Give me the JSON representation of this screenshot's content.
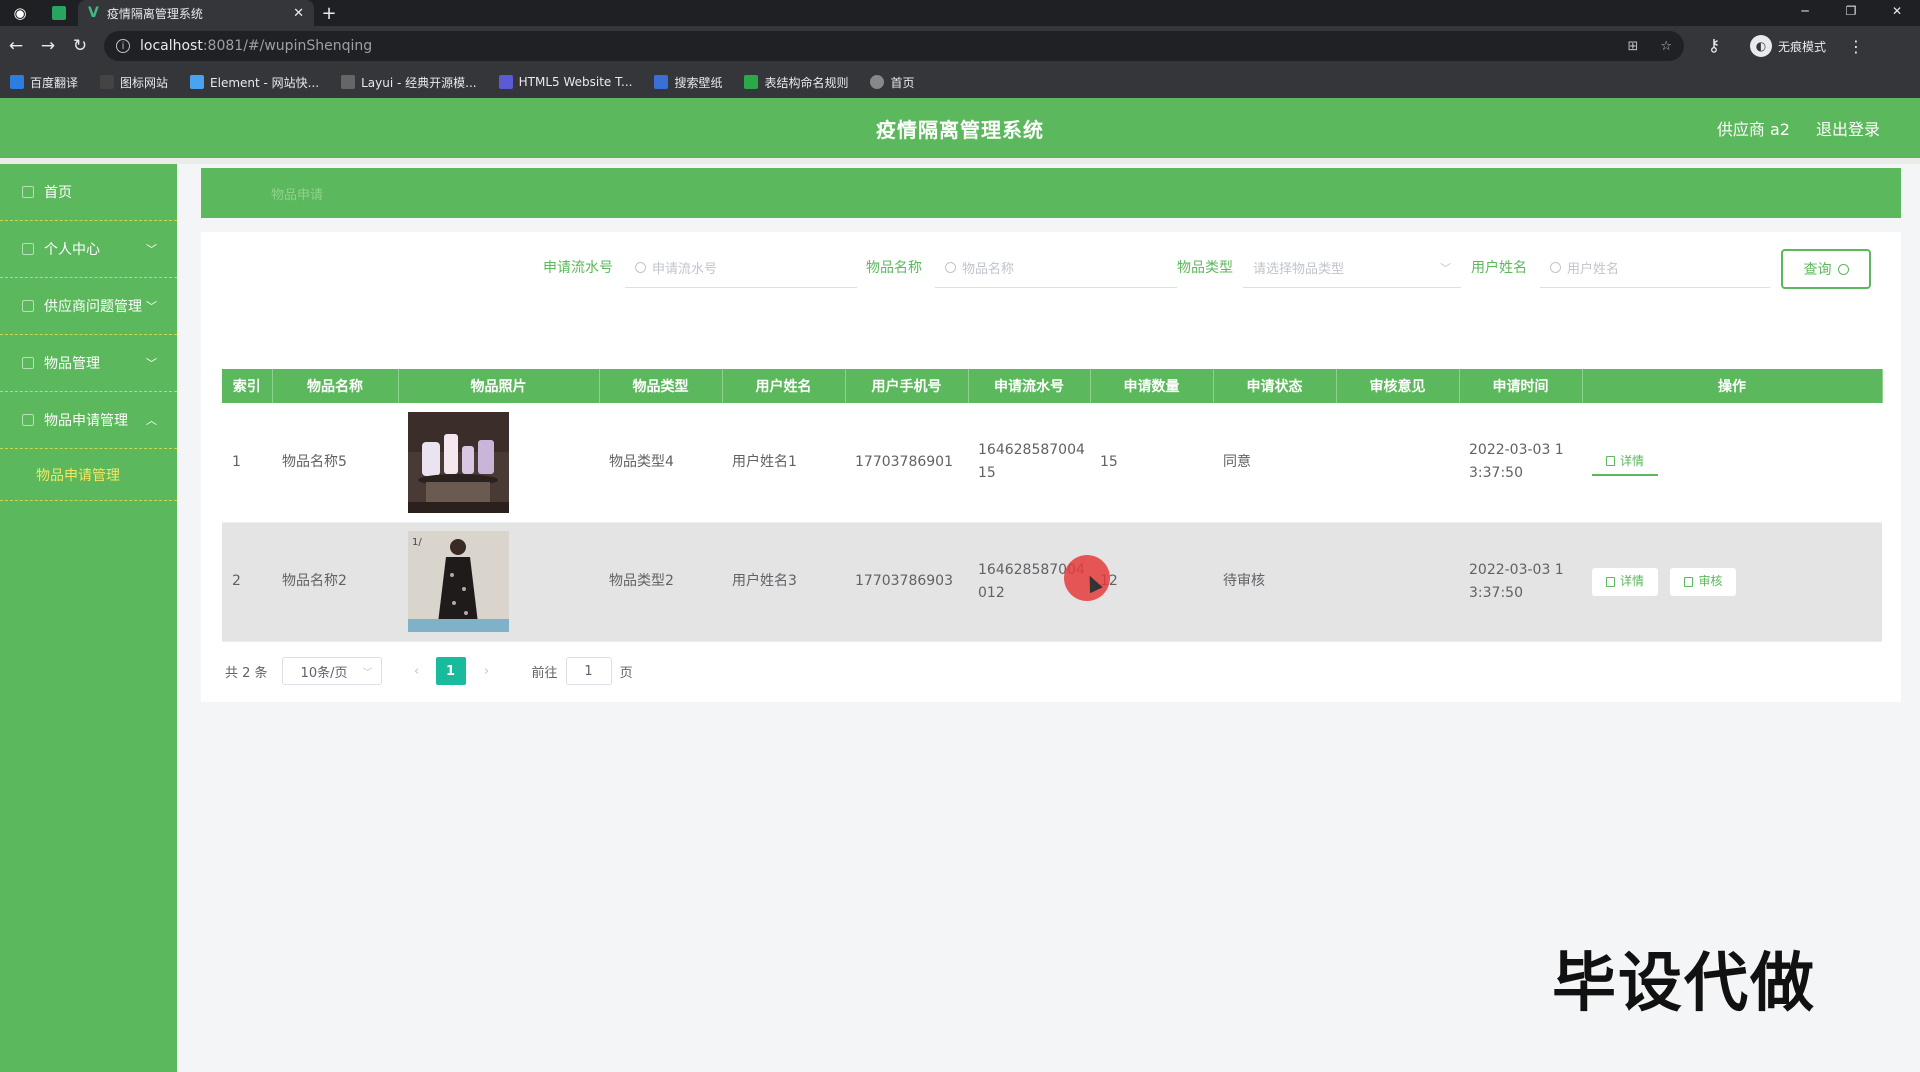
{
  "browser": {
    "tab_title": "疫情隔离管理系统",
    "url_host": "localhost",
    "url_path": ":8081/#/wupinShenqing",
    "profile_label": "无痕模式",
    "bookmarks": [
      {
        "label": "百度翻译",
        "color": "#2c7de0"
      },
      {
        "label": "图标网站",
        "color": "#444444"
      },
      {
        "label": "Element - 网站快...",
        "color": "#4aa3f0"
      },
      {
        "label": "Layui - 经典开源模...",
        "color": "#666666"
      },
      {
        "label": "HTML5 Website T...",
        "color": "#5b5bd6"
      },
      {
        "label": "搜索壁纸",
        "color": "#3a6fd8"
      },
      {
        "label": "表结构命名规则",
        "color": "#2aa84a"
      },
      {
        "label": "首页",
        "color": "#888888"
      }
    ]
  },
  "header": {
    "title": "疫情隔离管理系统",
    "user": "供应商 a2",
    "logout": "退出登录",
    "color": "#5cb85c"
  },
  "sidebar": {
    "items": [
      {
        "label": "首页"
      },
      {
        "label": "个人中心"
      },
      {
        "label": "供应商问题管理"
      },
      {
        "label": "物品管理"
      },
      {
        "label": "物品申请管理"
      }
    ],
    "submenu_active": "物品申请管理"
  },
  "breadcrumb": "物品申请",
  "search": {
    "fields": [
      {
        "label": "申请流水号",
        "placeholder": "申请流水号"
      },
      {
        "label": "物品名称",
        "placeholder": "物品名称"
      },
      {
        "label": "物品类型",
        "placeholder": "请选择物品类型"
      },
      {
        "label": "用户姓名",
        "placeholder": "用户姓名"
      }
    ],
    "button": "查询"
  },
  "table": {
    "headers": [
      "索引",
      "物品名称",
      "物品照片",
      "物品类型",
      "用户姓名",
      "用户手机号",
      "申请流水号",
      "申请数量",
      "申请状态",
      "审核意见",
      "申请时间",
      "操作"
    ],
    "rows": [
      {
        "index": "1",
        "name": "物品名称5",
        "type": "物品类型4",
        "user": "用户姓名1",
        "phone": "17703786901",
        "serial_a": "164628587004",
        "serial_b": "15",
        "qty": "15",
        "status": "同意",
        "opinion": "",
        "time_a": "2022-03-03 1",
        "time_b": "3:37:50",
        "ops": [
          "详情"
        ]
      },
      {
        "index": "2",
        "name": "物品名称2",
        "type": "物品类型2",
        "user": "用户姓名3",
        "phone": "17703786903",
        "serial_a": "164628587004",
        "serial_b": "012",
        "qty": "12",
        "status": "待审核",
        "opinion": "",
        "time_a": "2022-03-03 1",
        "time_b": "3:37:50",
        "ops": [
          "详情",
          "审核"
        ]
      }
    ]
  },
  "pager": {
    "total": "共 2 条",
    "page_size": "10条/页",
    "current": "1",
    "goto_prefix": "前往",
    "goto_value": "1",
    "goto_suffix": "页"
  },
  "watermark": "毕设代做"
}
